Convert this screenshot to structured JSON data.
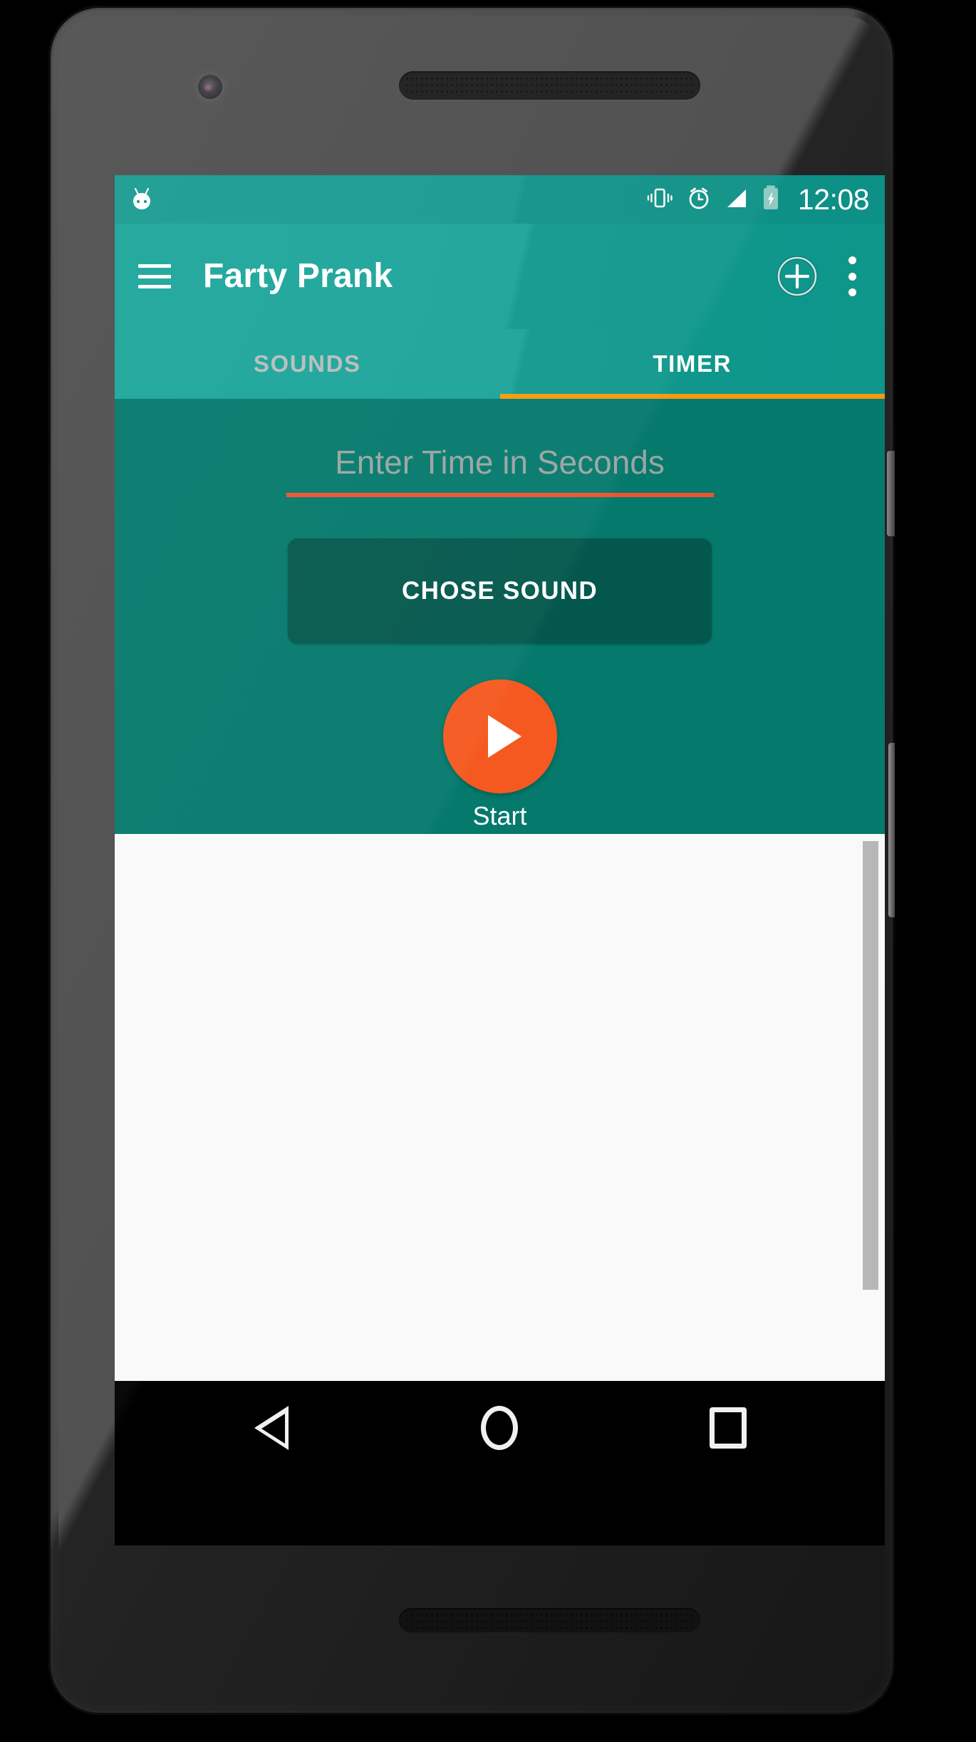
{
  "device": {
    "name": "android-phone-mockup",
    "camera_icon": "front-camera-icon",
    "earpiece_icon": "earpiece-speaker-icon",
    "bottom_speaker_icon": "bottom-speaker-icon",
    "power_button": "power-button",
    "volume_button": "volume-rocker-button"
  },
  "status_bar": {
    "mascot_icon": "android-mascot-icon",
    "icons": [
      {
        "name": "vibrate-icon",
        "label": "Vibrate"
      },
      {
        "name": "alarm-icon",
        "label": "Alarm"
      },
      {
        "name": "signal-icon",
        "label": "Signal"
      },
      {
        "name": "battery-charging-icon",
        "label": "Battery charging"
      }
    ],
    "time": "12:08",
    "background_color": "#0f9288"
  },
  "app_bar": {
    "menu_icon": "hamburger-menu-icon",
    "title": "Farty Prank",
    "add_icon": "add-circle-icon",
    "overflow_icon": "overflow-menu-icon",
    "background_color": "#10988d"
  },
  "tabs": {
    "items": [
      {
        "label": "SOUNDS",
        "active": false
      },
      {
        "label": "TIMER",
        "active": true
      }
    ],
    "indicator_color": "#f59a0b",
    "active_color": "#ffffff",
    "inactive_color": "#b8bdbc"
  },
  "timer_panel": {
    "background_color": "#04796c",
    "time_input": {
      "placeholder": "Enter Time in Seconds",
      "value": "",
      "underline_color": "#f0532b"
    },
    "chose_sound_label": "CHOSE SOUND",
    "chose_sound_color": "#03574c",
    "start_button": {
      "icon": "play-icon",
      "label": "Start",
      "color": "#f5591f"
    }
  },
  "content_area": {
    "background_color": "#f8f9f8",
    "scrollbar": "vertical-scrollbar"
  },
  "nav_bar": {
    "background_color": "#000000",
    "buttons": [
      {
        "name": "nav-back-button",
        "icon": "back-triangle-icon"
      },
      {
        "name": "nav-home-button",
        "icon": "home-circle-icon"
      },
      {
        "name": "nav-recents-button",
        "icon": "recents-square-icon"
      }
    ]
  }
}
